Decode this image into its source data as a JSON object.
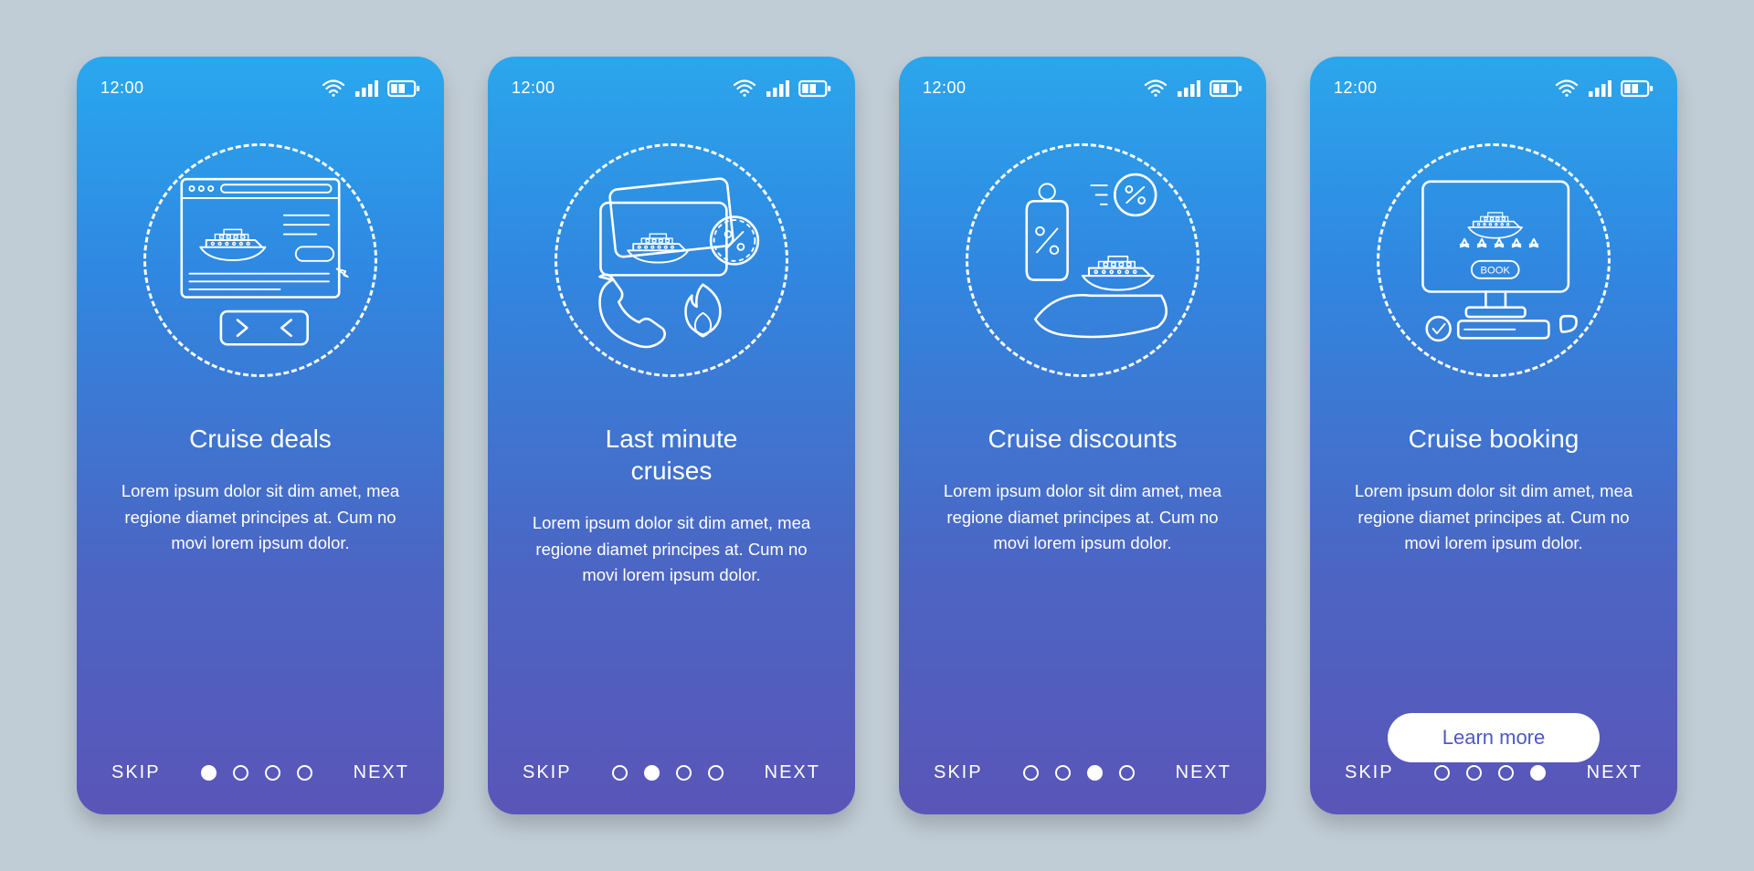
{
  "status_time": "12:00",
  "common": {
    "skip_label": "SKIP",
    "next_label": "NEXT",
    "body_text": "Lorem ipsum dolor sit dim amet, mea regione diamet principes at. Cum no movi lorem ipsum dolor.",
    "learn_more_label": "Learn more"
  },
  "illustration_names": {
    "s1": "browser-cruise-deal-icon",
    "s2": "ticket-hot-call-icon",
    "s3": "discount-tag-ship-icon",
    "s4": "monitor-booking-icon"
  },
  "screens": [
    {
      "title": "Cruise deals",
      "active_dot": 0,
      "cta": false
    },
    {
      "title": "Last minute\ncruises",
      "active_dot": 1,
      "cta": false
    },
    {
      "title": "Cruise discounts",
      "active_dot": 2,
      "cta": false
    },
    {
      "title": "Cruise booking",
      "active_dot": 3,
      "cta": true
    }
  ]
}
